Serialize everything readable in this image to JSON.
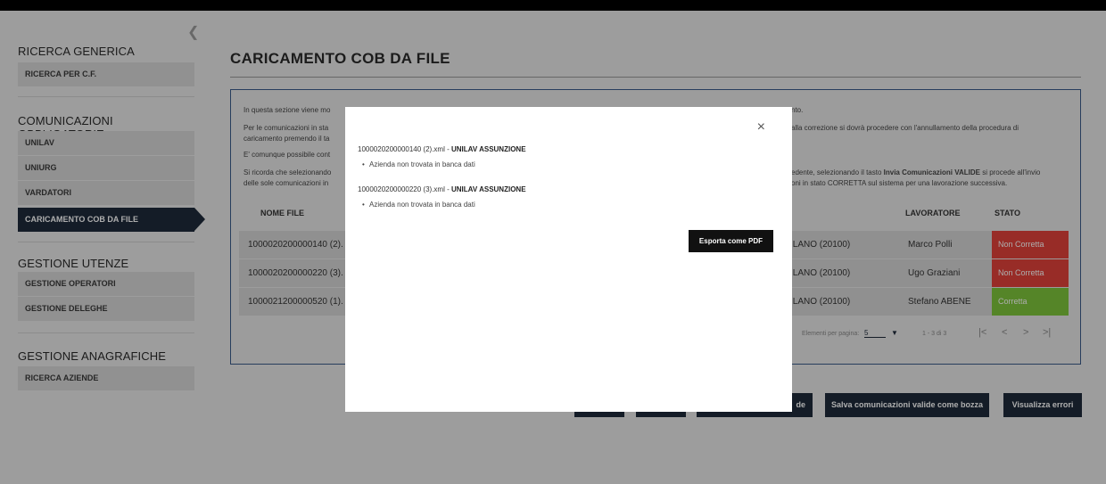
{
  "sidebar": {
    "generica_title": "RICERCA GENERICA",
    "ricerca_cf": "RICERCA PER C.F.",
    "comunicazioni_title": "COMUNICAZIONI OBBLIGATORIE",
    "items": [
      "UNILAV",
      "UNIURG",
      "VARDATORI",
      "CARICAMENTO COB DA FILE"
    ],
    "utenze_title": "GESTIONE UTENZE",
    "utenze_items": [
      "GESTIONE OPERATORI",
      "GESTIONE DELEGHE"
    ],
    "anagrafiche_title": "GESTIONE ANAGRAFICHE",
    "anagrafiche_items": [
      "RICERCA AZIENDE"
    ]
  },
  "page": {
    "title": "CARICAMENTO COB DA FILE",
    "info_1": "In questa sezione viene mo",
    "info_1b": "nto.",
    "info_2": "Per le comunicazioni in sta",
    "info_2b": "alla correzione si dovrà procedere con l'annullamento della procedura di",
    "info_3": "caricamento premendo il ta",
    "info_4": "E' comunque possibile cont",
    "info_5": "Si ricorda che selezionando",
    "info_5b": "edente, selezionando il tasto",
    "info_5c": "Invia Comunicazioni VALIDE",
    "info_5d": "si procede all'invio",
    "info_6": "delle sole comunicazioni in",
    "info_6b": "oni in stato CORRETTA sul sistema per una lavorazione successiva."
  },
  "table": {
    "col_file": "NOME FILE",
    "col_lavoratore": "LAVORATORE",
    "col_stato": "STATO",
    "rows": [
      {
        "file": "1000020200000140 (2).",
        "sede": "ILANO (20100)",
        "lavoratore": "Marco Polli",
        "stato": "Non Corretta"
      },
      {
        "file": "1000020200000220 (3).",
        "sede": "ILANO (20100)",
        "lavoratore": "Ugo Graziani",
        "stato": "Non Corretta"
      },
      {
        "file": "1000021200000520 (1).",
        "sede": "ILANO (20100)",
        "lavoratore": "Stefano ABENE",
        "stato": "Corretta"
      }
    ],
    "pager": {
      "label": "Elementi per pagina:",
      "size": "5",
      "range": "1 - 3 di 3"
    }
  },
  "buttons": {
    "partial": "de",
    "salva_bozza": "Salva comunicazioni valide come bozza",
    "visualizza_errori": "Visualizza errori"
  },
  "modal": {
    "entries": [
      {
        "file": "1000020200000140 (2).xml - ",
        "type": "UNILAV ASSUNZIONE",
        "error": "Azienda non trovata in banca dati"
      },
      {
        "file": "1000020200000220 (3).xml - ",
        "type": "UNILAV ASSUNZIONE",
        "error": "Azienda non trovata in banca dati"
      }
    ],
    "export_label": "Esporta come PDF",
    "close": "×"
  },
  "colors": {
    "nav_active": "#1e2a3a",
    "error": "#e0413a",
    "ok": "#7ec43b"
  }
}
